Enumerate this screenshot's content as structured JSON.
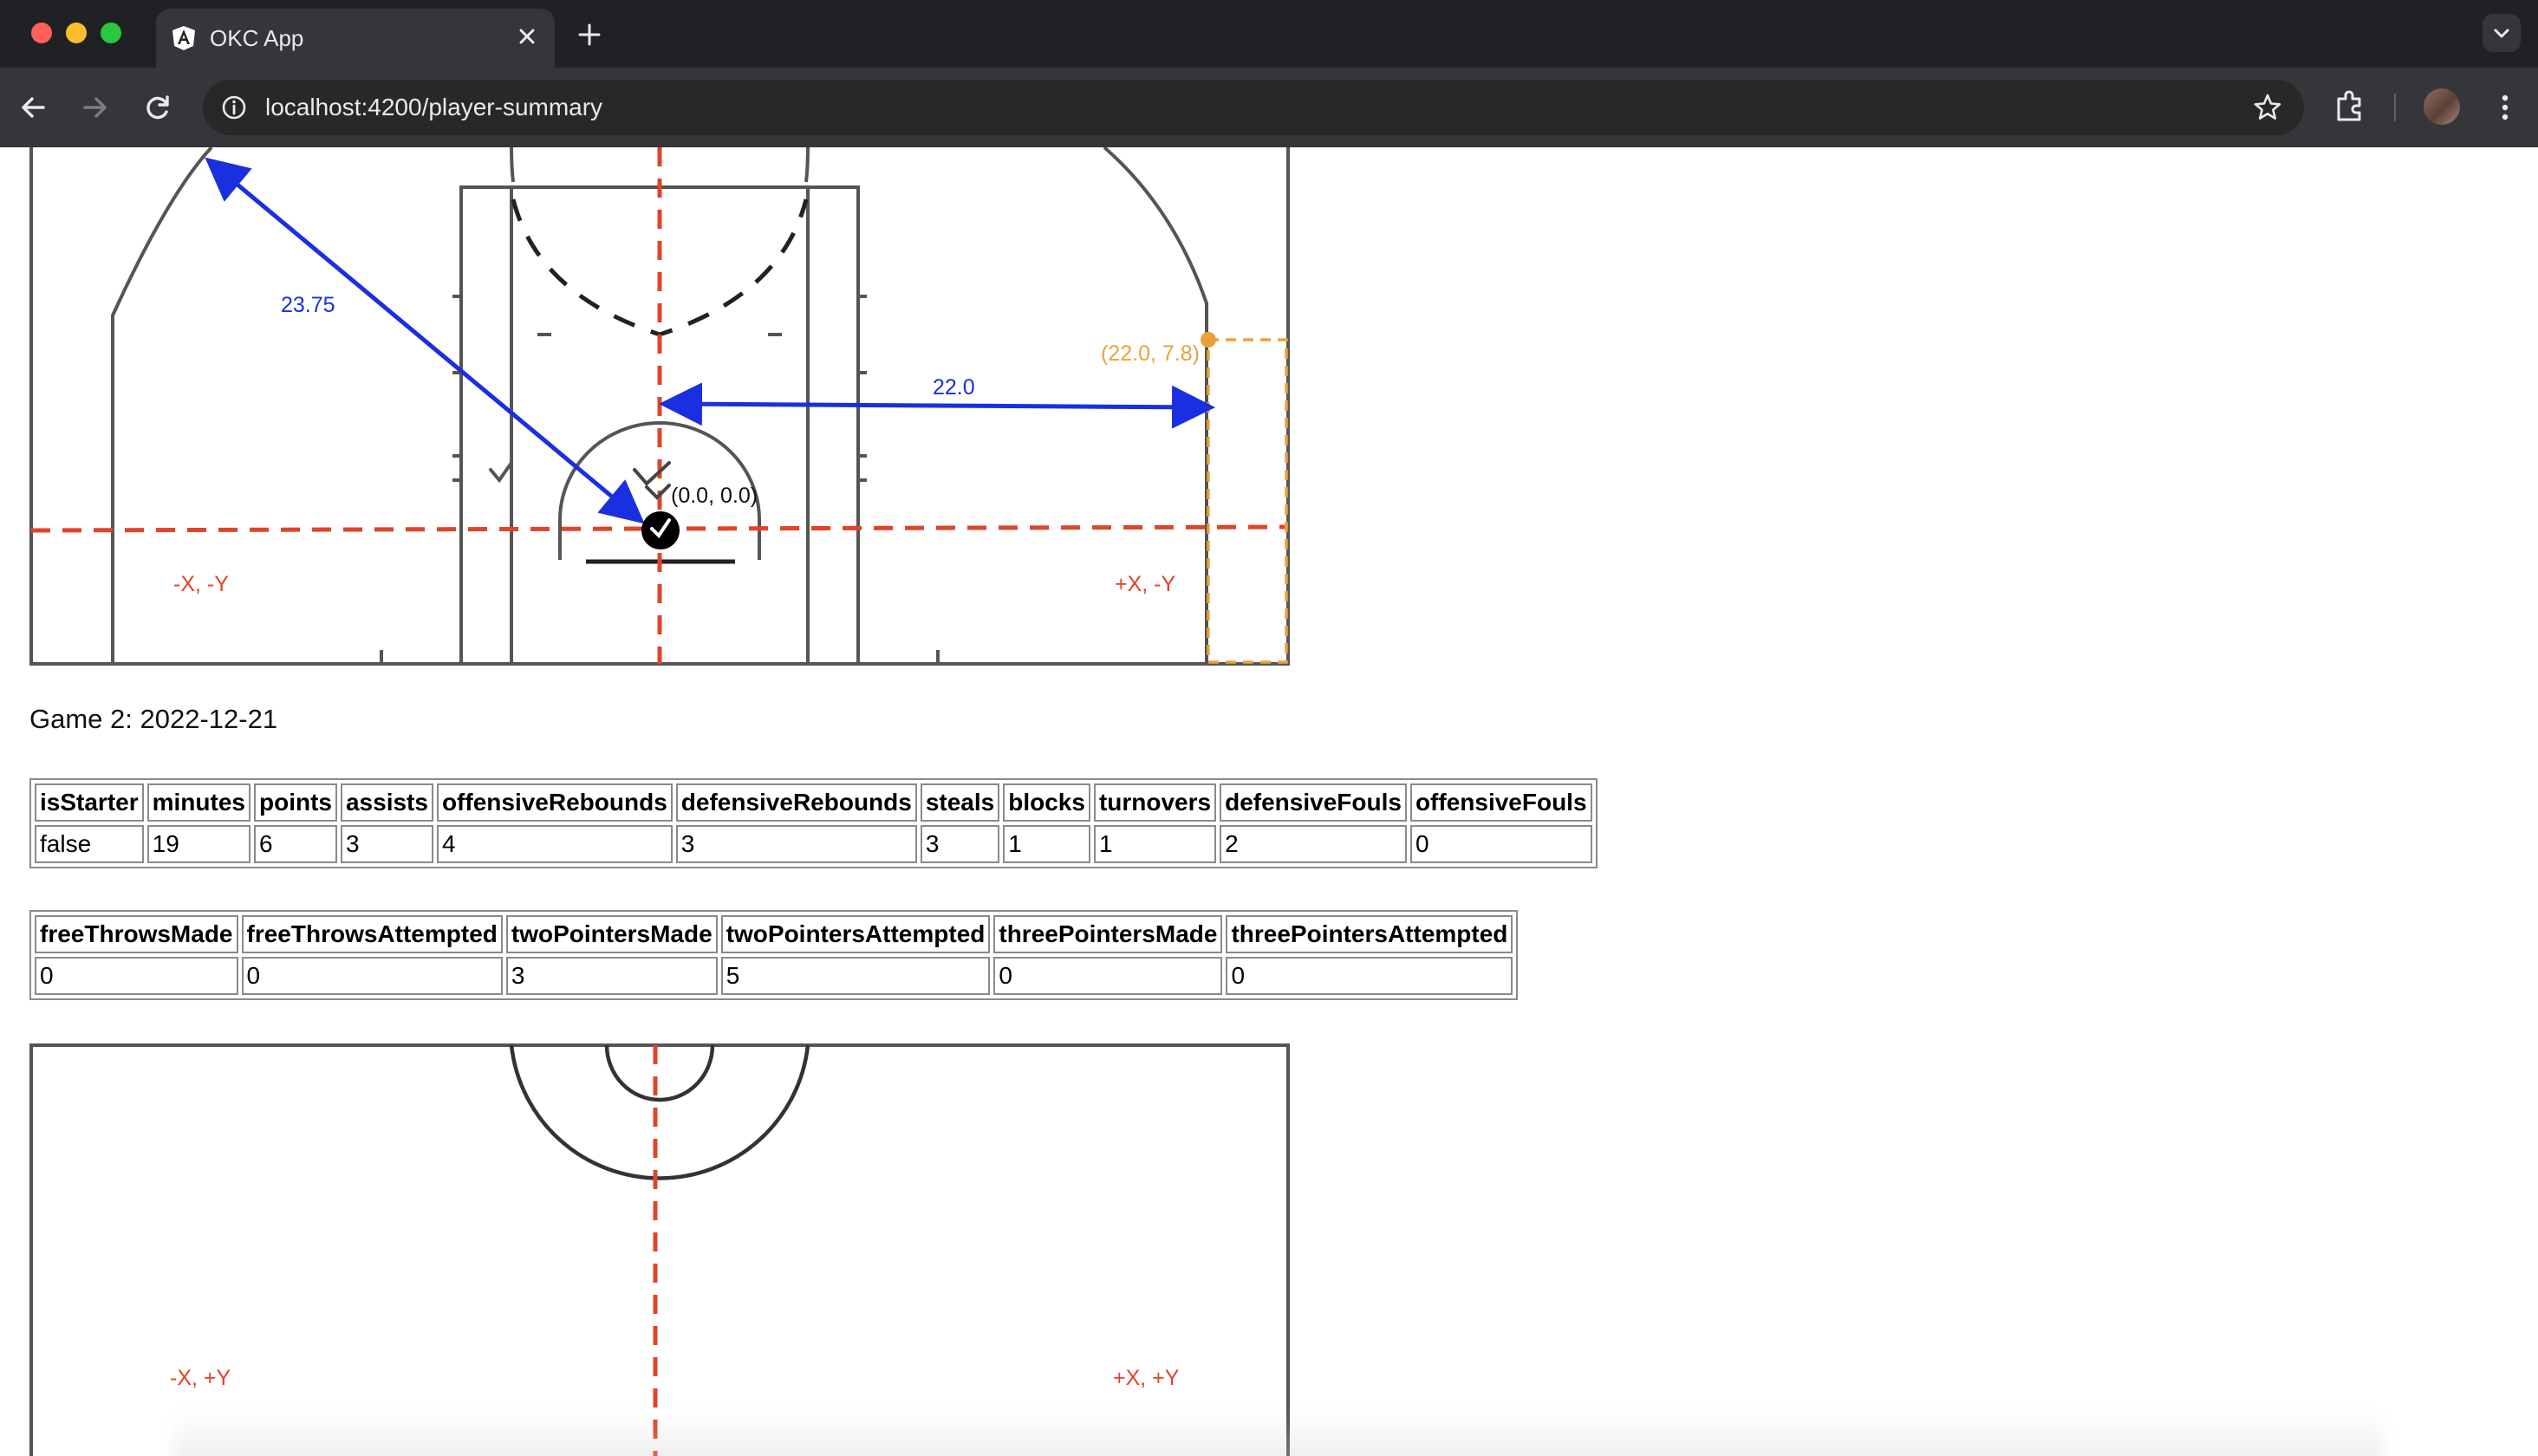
{
  "browser": {
    "tab_title": "OKC App",
    "url": "localhost:4200/player-summary"
  },
  "court_top": {
    "distance_corner_label": "23.75",
    "distance_side_label": "22.0",
    "orange_point_label": "(22.0, 7.8)",
    "origin_label": "(0.0, 0.0)",
    "quadrant_left": "-X, -Y",
    "quadrant_right": "+X, -Y"
  },
  "game": {
    "title": "Game 2: 2022-12-21"
  },
  "table1": {
    "headers": [
      "isStarter",
      "minutes",
      "points",
      "assists",
      "offensiveRebounds",
      "defensiveRebounds",
      "steals",
      "blocks",
      "turnovers",
      "defensiveFouls",
      "offensiveFouls"
    ],
    "values": [
      "false",
      "19",
      "6",
      "3",
      "4",
      "3",
      "3",
      "1",
      "1",
      "2",
      "0"
    ]
  },
  "table2": {
    "headers": [
      "freeThrowsMade",
      "freeThrowsAttempted",
      "twoPointersMade",
      "twoPointersAttempted",
      "threePointersMade",
      "threePointersAttempted"
    ],
    "values": [
      "0",
      "0",
      "3",
      "5",
      "0",
      "0"
    ]
  },
  "court_bottom": {
    "quadrant_left": "-X, +Y",
    "quadrant_right": "+X, +Y"
  },
  "colors": {
    "axis_red": "#e0442b",
    "arrow_blue": "#1a2fe0",
    "highlight_orange": "#e9a23b",
    "court_line": "#3a3a3a"
  },
  "icons": [
    "close-icon",
    "plus-icon",
    "back-arrow-icon",
    "forward-arrow-icon",
    "reload-icon",
    "info-icon",
    "star-icon",
    "extensions-icon",
    "avatar",
    "more-vert-icon",
    "chevron-down-icon",
    "angular-logo-icon",
    "checkmark-icon"
  ]
}
